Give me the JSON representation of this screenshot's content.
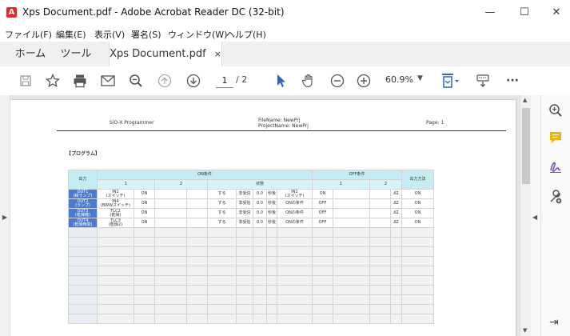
{
  "window": {
    "title": "Xps Document.pdf - Adobe Acrobat Reader DC (32-bit)",
    "minimize": "—",
    "maximize": "☐",
    "close": "✕"
  },
  "menu": [
    "ファイル(F)",
    "編集(E)",
    "表示(V)",
    "署名(S)",
    "ウィンドウ(W)",
    "ヘルプ(H)"
  ],
  "tabs": {
    "home": "ホーム",
    "tools": "ツール",
    "doc": "Xps Document.pdf",
    "doc_close": "×"
  },
  "toolbar": {
    "icons": [
      "save-icon",
      "bookmark-star-icon",
      "print-icon",
      "email-icon",
      "zoom-search-icon",
      "page-up-icon",
      "page-down-icon",
      "select-arrow-icon",
      "hand-icon",
      "zoom-out-icon",
      "zoom-in-icon",
      "fit-page-icon",
      "keyboard-icon",
      "more-icon"
    ],
    "page_current": "1",
    "page_total": "/ 2",
    "zoom": "60.9%",
    "more": "···"
  },
  "document": {
    "header_left": "SiO-X Programmer",
    "header_mid_1": "FileName: NewPrj",
    "header_mid_2": "ProjectName: NewPrj",
    "header_right": "Page: 1",
    "section": "【プログラム】",
    "col_output": "出力",
    "col_on": "ON条件",
    "col_off": "OFF条件",
    "col_method": "出力方法",
    "sub_1": "1",
    "sub_2": "2",
    "sub_state": "状態",
    "sub_off_1": "1",
    "sub_off_2": "2",
    "rows": [
      {
        "out": "OUT1\n(緑ランプ)",
        "on1": "IN1\n(スイッチ)",
        "on1v": "ON",
        "s1": "する",
        "s2": "非受信",
        "s3": "0.0",
        "s4": "秒後",
        "off1": "IN1\n(スイッチ)",
        "off1v": "ON",
        "m1": "ΔΣ",
        "method": "ON"
      },
      {
        "out": "OUT2\n(ランプ)",
        "on1": "IN4\n(BWWスイッチ)",
        "on1v": "ON",
        "s1": "する",
        "s2": "非受信",
        "s3": "0.0",
        "s4": "秒後",
        "off1": "ONの条件",
        "off1v": "OFF",
        "m1": "ΔΣ",
        "method": "ON"
      },
      {
        "out": "OUT3\n(乾燥機)",
        "on1": "TLC2\n(乾燥)",
        "on1v": "ON",
        "s1": "する",
        "s2": "非受信",
        "s3": "0.0",
        "s4": "秒後",
        "off1": "ONの条件",
        "off1v": "OFF",
        "m1": "ΔΣ",
        "method": "ON"
      },
      {
        "out": "OUT4\n(乾燥時間)",
        "on1": "TLC3\n(乾燥2)",
        "on1v": "ON",
        "s1": "する",
        "s2": "非受信",
        "s3": "0.0",
        "s4": "秒後",
        "off1": "ONの条件",
        "off1v": "OFF",
        "m1": "ΔΣ",
        "method": "ON"
      }
    ],
    "empty_rows": 10
  },
  "right_tools": [
    "zoom-panel-icon",
    "comment-icon",
    "sign-icon",
    "tools-add-icon",
    "expand-panel-icon"
  ]
}
